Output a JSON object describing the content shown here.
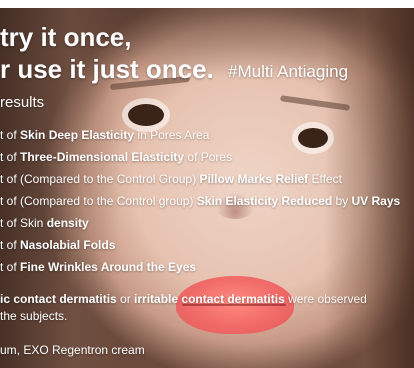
{
  "headline": {
    "line1": "try it once,",
    "line2": "r use it just once."
  },
  "hashtag": "#Multi Antiaging",
  "results_label": "results",
  "items": [
    {
      "pre": "t of ",
      "bold": "Skin Deep Elasticity",
      "post": " in Pores Area"
    },
    {
      "pre": "t of ",
      "bold": "Three-Dimensional Elasticity",
      "post": " of Pores"
    },
    {
      "pre": "t of (Compared to the Control Group) ",
      "bold": "Pillow Marks Relief",
      "post": " Effect"
    },
    {
      "pre": "t of (Compared to the Control group) ",
      "bold": "Skin Elasticity Reduced",
      "mid": " by ",
      "bold2": "UV Rays"
    },
    {
      "pre": "t of Skin ",
      "bold": "density",
      "post": ""
    },
    {
      "pre": "t of ",
      "bold": "Nasolabial Folds",
      "post": ""
    },
    {
      "pre": "t of ",
      "bold": "Fine Wrinkles Around the Eyes",
      "post": ""
    }
  ],
  "note": {
    "line1_bold1": "ic contact dermatitis",
    "line1_mid": " or ",
    "line1_bold2": "irritable contact dermatitis",
    "line1_post": " were observed",
    "line2": " the subjects."
  },
  "footer": "um, EXO Regentron cream"
}
